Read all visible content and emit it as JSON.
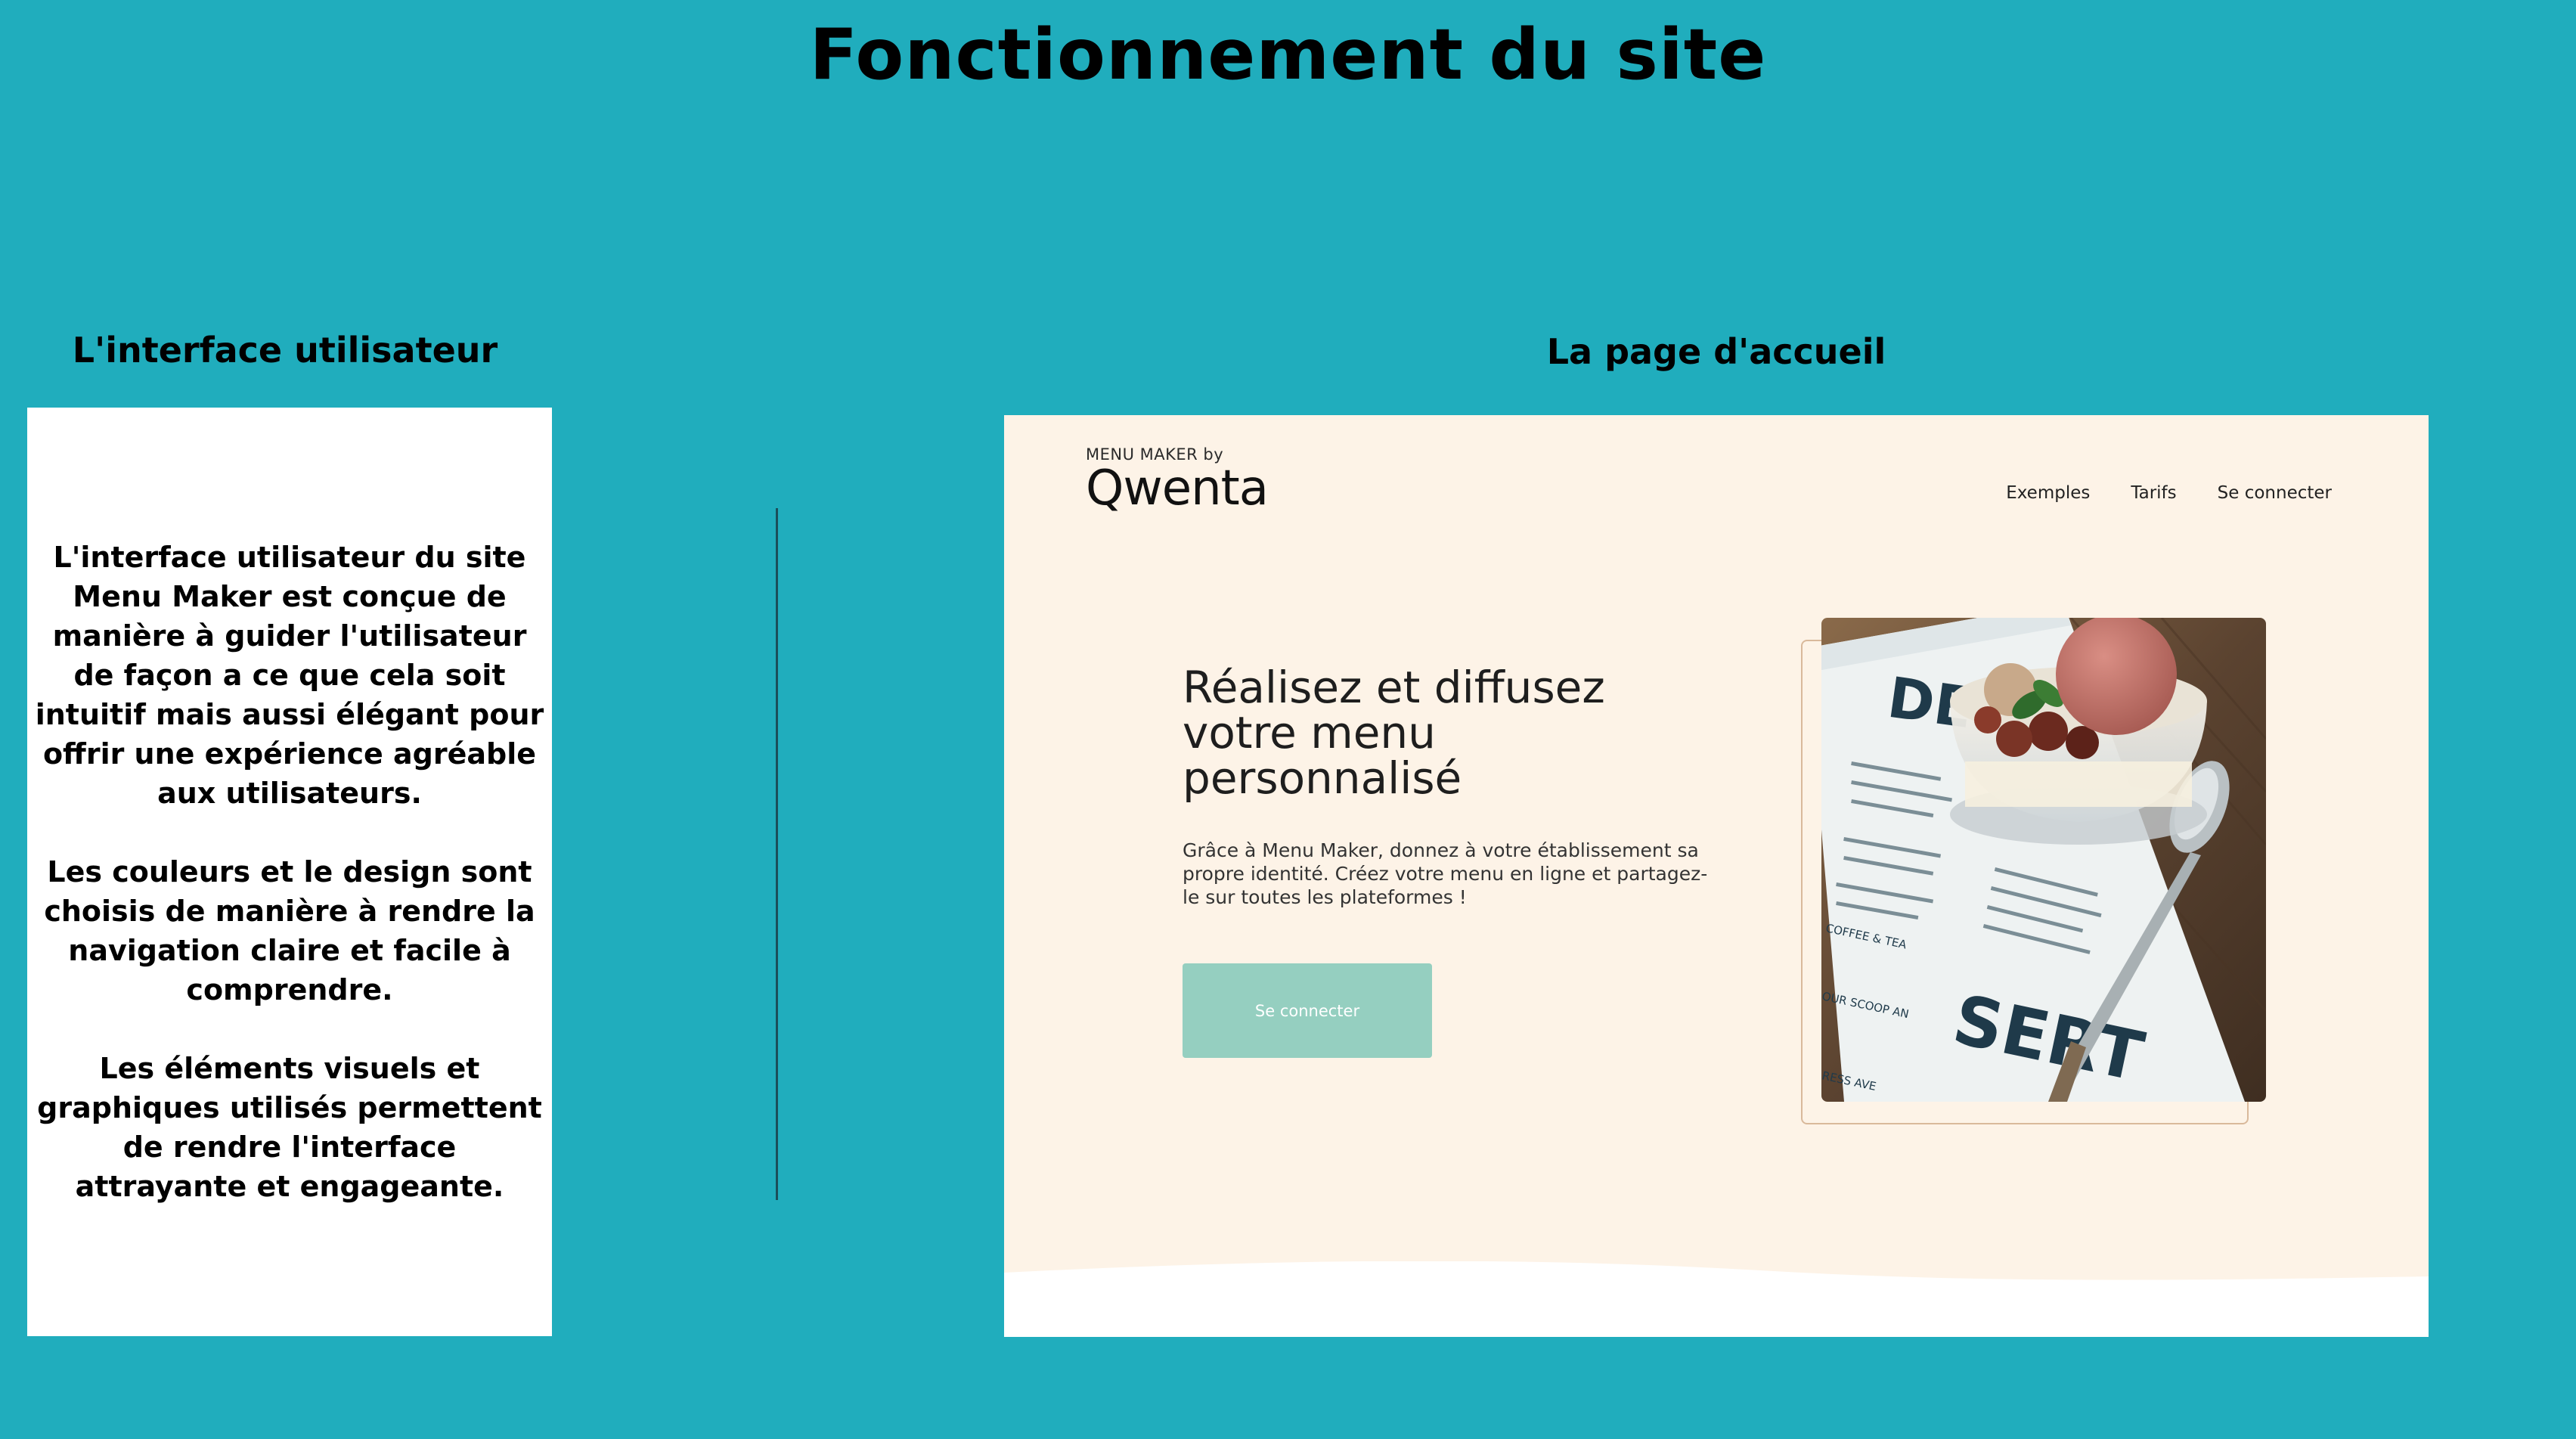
{
  "slide": {
    "title": "Fonctionnement du site",
    "left_heading": "L'interface utilisateur",
    "right_heading": "La page d'accueil",
    "paragraphs": [
      "L'interface utilisateur du site Menu Maker est conçue de manière à guider l'utilisateur de façon a ce que cela soit intuitif mais aussi élégant pour offrir une expérience agréable aux utilisateurs.",
      "Les couleurs et le design sont choisis de manière à rendre la navigation claire et facile à comprendre.",
      "Les éléments visuels et graphiques utilisés permettent de rendre l'interface attrayante et engageante."
    ]
  },
  "homepage": {
    "brand_small": "MENU MAKER by",
    "brand_logo": "Qwenta",
    "nav": [
      "Exemples",
      "Tarifs",
      "Se connecter"
    ],
    "hero_title": "Réalisez et diffusez votre menu personnalisé",
    "hero_description": "Grâce à Menu Maker, donnez à votre établissement sa propre identité. Créez votre menu en ligne et partagez-le sur toutes les plateformes !",
    "cta_label": "Se connecter",
    "photo": {
      "menu_top_letters": "DE",
      "menu_bottom_letters": "SERT",
      "menu_section_1": "COFFEE & TEA",
      "menu_section_2": "OUR SCOOP AN",
      "menu_footer": "RESS AVE"
    }
  },
  "colors": {
    "background": "#20adbd",
    "panel": "#ffffff",
    "homepage_bg": "#fdf3e7",
    "cta": "#95cfc0"
  }
}
